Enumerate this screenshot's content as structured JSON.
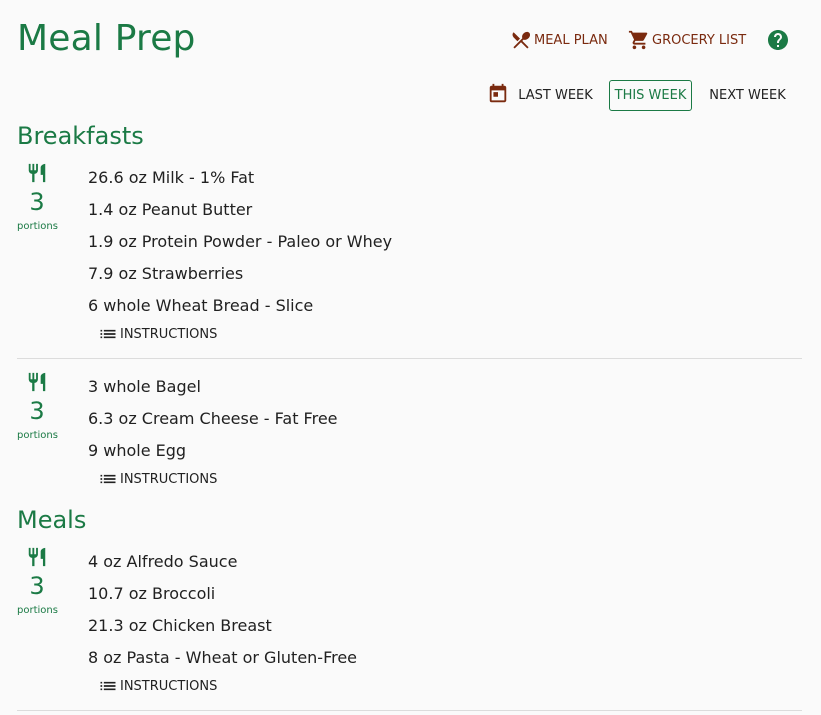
{
  "app": {
    "title": "Meal Prep"
  },
  "header": {
    "meal_plan_label": "MEAL PLAN",
    "grocery_list_label": "GROCERY LIST"
  },
  "week_nav": {
    "last_week": "LAST WEEK",
    "this_week": "THIS WEEK",
    "next_week": "NEXT WEEK",
    "selected": "THIS WEEK"
  },
  "sections": {
    "breakfasts": {
      "title": "Breakfasts",
      "cards": [
        {
          "portions": "3",
          "portions_label": "portions",
          "ingredients": [
            "26.6 oz Milk - 1% Fat",
            "1.4 oz Peanut Butter",
            "1.9 oz Protein Powder - Paleo or Whey",
            "7.9 oz Strawberries",
            "6 whole Wheat Bread - Slice"
          ],
          "instructions_label": "INSTRUCTIONS"
        },
        {
          "portions": "3",
          "portions_label": "portions",
          "ingredients": [
            "3 whole Bagel",
            "6.3 oz Cream Cheese - Fat Free",
            "9 whole Egg"
          ],
          "instructions_label": "INSTRUCTIONS"
        }
      ]
    },
    "meals": {
      "title": "Meals",
      "cards": [
        {
          "portions": "3",
          "portions_label": "portions",
          "ingredients": [
            "4 oz Alfredo Sauce",
            "10.7 oz Broccoli",
            "21.3 oz Chicken Breast",
            "8 oz Pasta - Wheat or Gluten-Free"
          ],
          "instructions_label": "INSTRUCTIONS"
        }
      ]
    }
  },
  "colors": {
    "brand_green": "#1b7a45",
    "nav_brown": "#7a2a0f",
    "background": "#fafafa",
    "text": "#212121"
  },
  "icons": {
    "meal_plan": "fork-knife-crossed-icon",
    "grocery_list": "cart-icon",
    "help": "help-circle-icon",
    "week": "calendar-icon",
    "portion": "fork-knife-icon",
    "instructions": "list-icon"
  }
}
